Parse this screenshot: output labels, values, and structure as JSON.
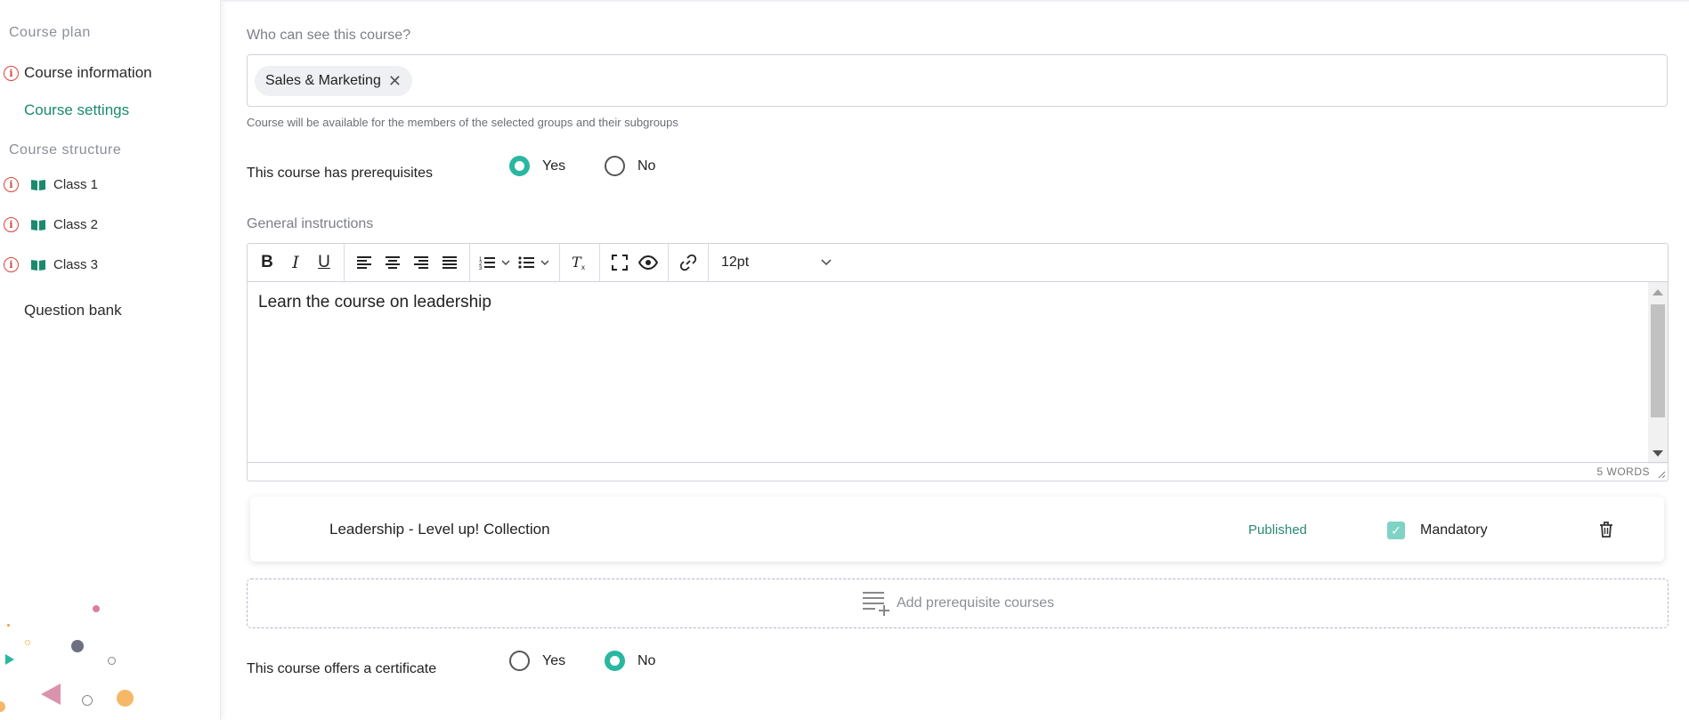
{
  "sidebar": {
    "course_plan_label": "Course plan",
    "course_information": "Course information",
    "course_settings": "Course settings",
    "course_structure_label": "Course structure",
    "classes": [
      "Class 1",
      "Class 2",
      "Class 3"
    ],
    "question_bank": "Question bank"
  },
  "visibility": {
    "label": "Who can see this course?",
    "tags": [
      "Sales & Marketing"
    ],
    "hint": "Course will be available for the members of the selected groups and their subgroups"
  },
  "prerequisites": {
    "label": "This course has prerequisites",
    "yes": "Yes",
    "no": "No",
    "selected": "Yes"
  },
  "instructions": {
    "label": "General instructions",
    "font_size": "12pt",
    "content": "Learn the course on leadership",
    "word_count": "5 WORDS"
  },
  "prereq_course": {
    "title": "Leadership - Level up! Collection",
    "status": "Published",
    "mandatory_label": "Mandatory",
    "mandatory": true
  },
  "add_prereq_label": "Add prerequisite courses",
  "certificate": {
    "label": "This course offers a certificate",
    "yes": "Yes",
    "no": "No",
    "selected": "No"
  },
  "colors": {
    "accent": "#2ab7a1",
    "warning": "#d9443a",
    "active_text": "#1a8a6e"
  }
}
